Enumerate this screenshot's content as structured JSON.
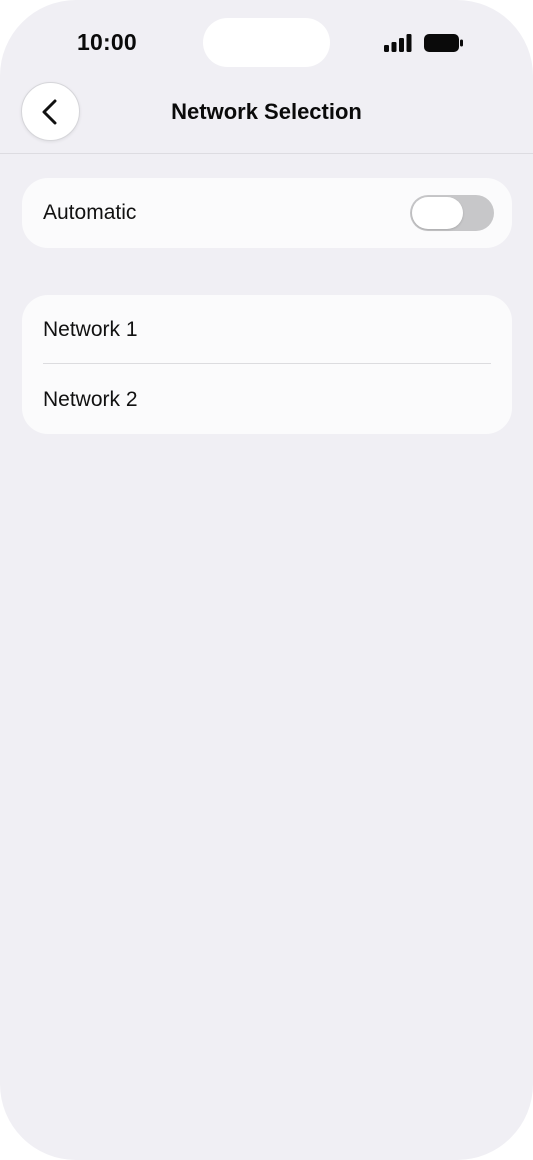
{
  "status_bar": {
    "time": "10:00",
    "signal_icon": "cellular-signal-icon",
    "battery_icon": "battery-full-icon"
  },
  "nav": {
    "back_icon": "chevron-left-icon",
    "title": "Network Selection"
  },
  "automatic": {
    "label": "Automatic",
    "enabled": false
  },
  "networks": [
    {
      "label": "Network 1"
    },
    {
      "label": "Network 2"
    }
  ],
  "colors": {
    "background": "#f0eff4",
    "card": "#fbfbfc",
    "toggle_off": "#c7c7c9"
  }
}
